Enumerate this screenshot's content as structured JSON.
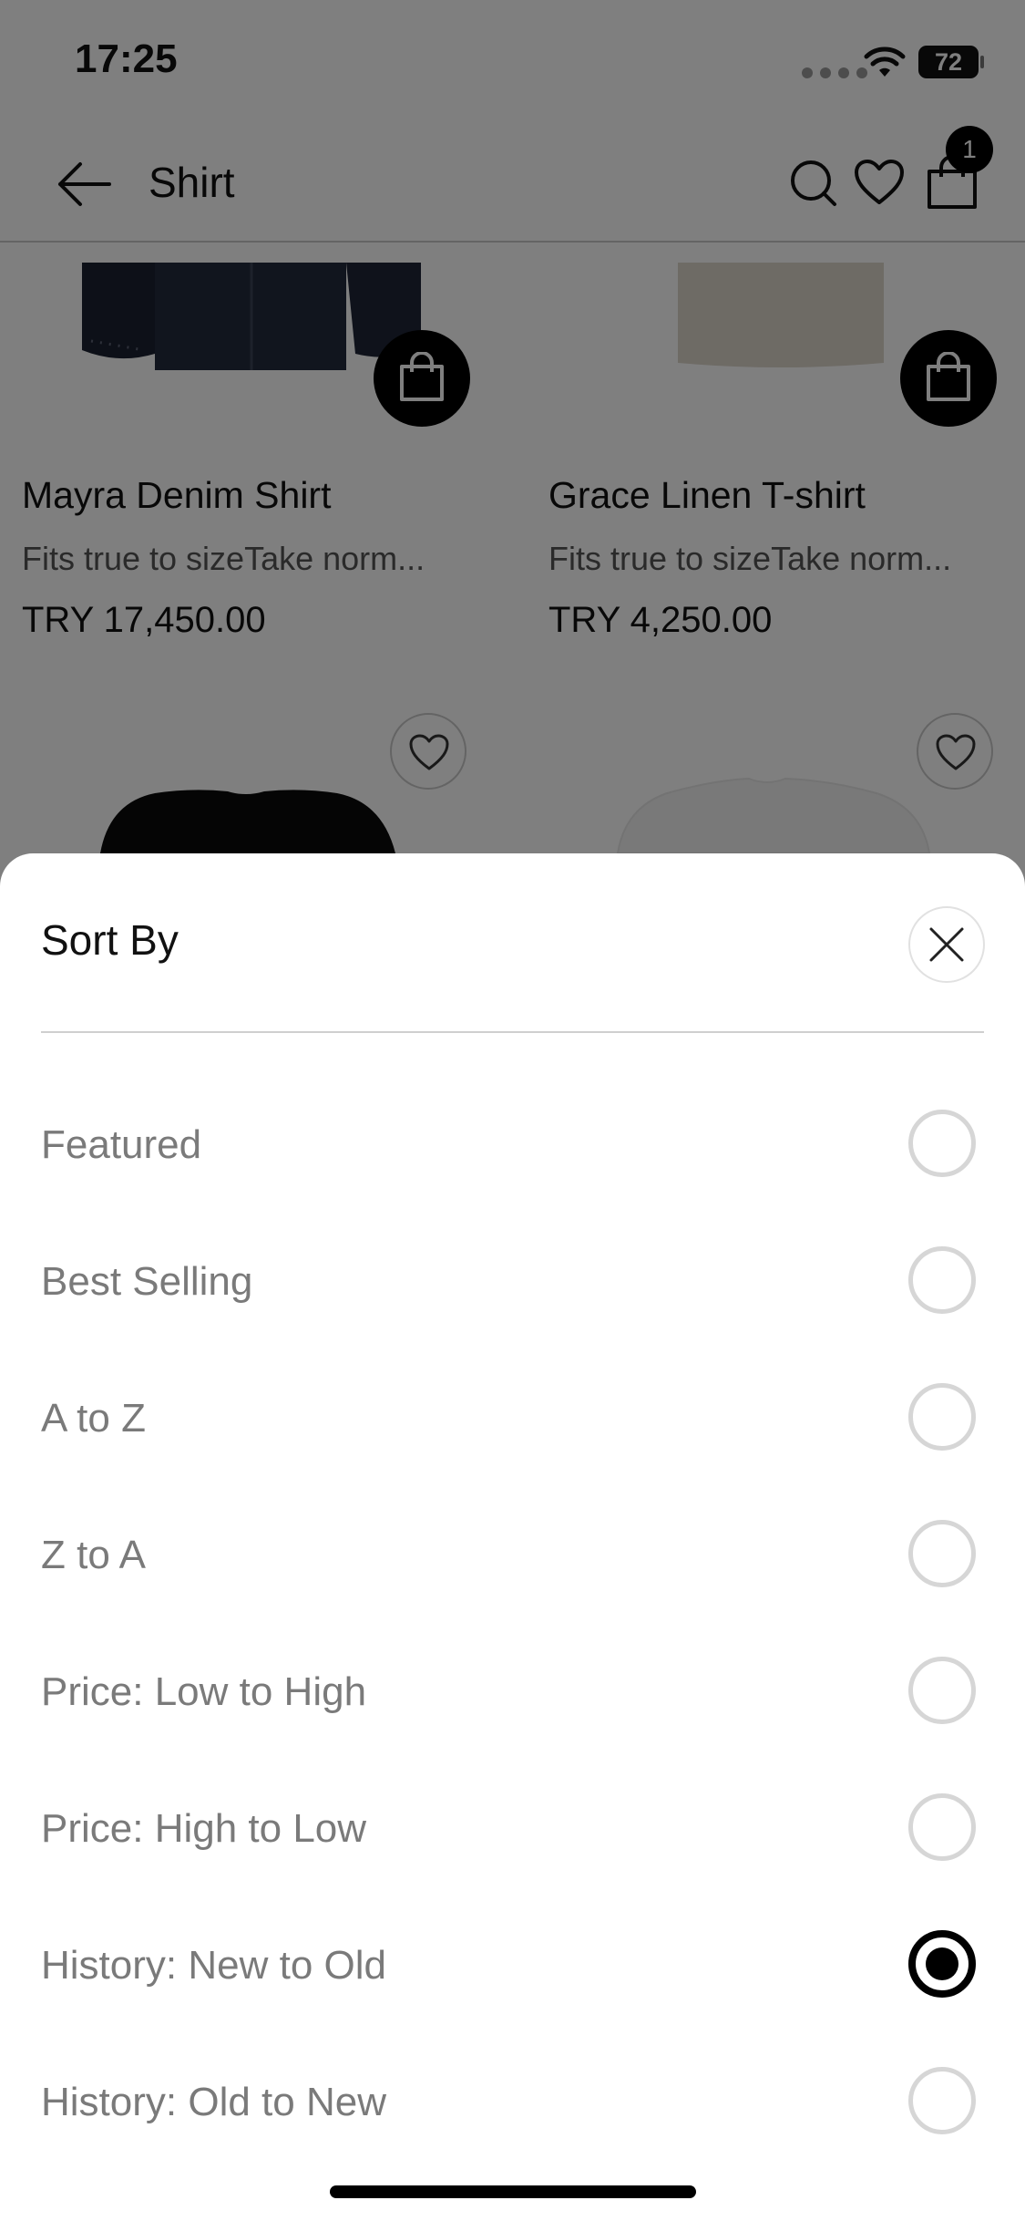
{
  "status_bar": {
    "time": "17:25",
    "battery": "72"
  },
  "header": {
    "title": "Shirt",
    "cart_count": "1"
  },
  "products": [
    {
      "name": "Mayra Denim Shirt",
      "description": "Fits true to sizeTake norm...",
      "price": "TRY 17,450.00"
    },
    {
      "name": "Grace Linen T-shirt",
      "description": "Fits true to sizeTake norm...",
      "price": "TRY 4,250.00"
    }
  ],
  "sort_sheet": {
    "title": "Sort By",
    "options": [
      {
        "label": "Featured",
        "selected": false
      },
      {
        "label": "Best Selling",
        "selected": false
      },
      {
        "label": "A to Z",
        "selected": false
      },
      {
        "label": "Z to A",
        "selected": false
      },
      {
        "label": "Price: Low to High",
        "selected": false
      },
      {
        "label": "Price: High to Low",
        "selected": false
      },
      {
        "label": "History: New to Old",
        "selected": true
      },
      {
        "label": "History: Old to New",
        "selected": false
      }
    ]
  },
  "icons": {
    "back": "arrow-left-icon",
    "search": "search-icon",
    "wishlist": "heart-icon",
    "bag": "shopping-bag-icon",
    "close": "close-icon",
    "wifi": "wifi-icon"
  },
  "colors": {
    "accent": "#000000",
    "overlay": "rgba(0,0,0,0.5)",
    "option_text": "#7a7a7a"
  }
}
